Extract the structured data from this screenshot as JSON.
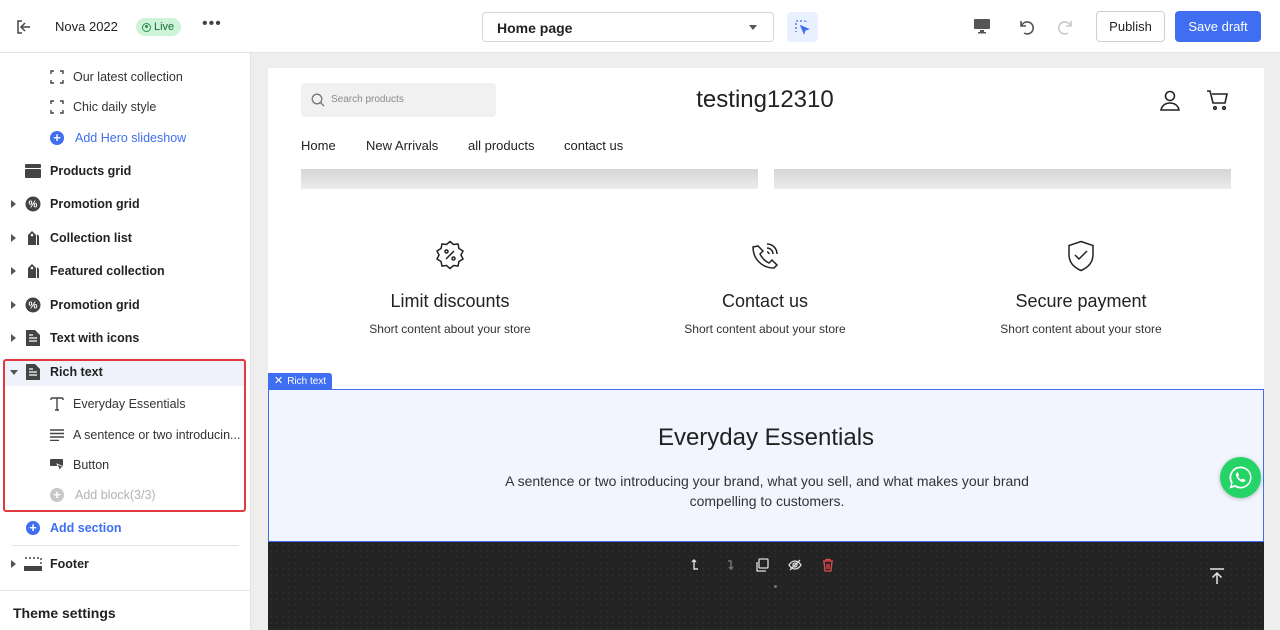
{
  "topbar": {
    "store_name": "Nova 2022",
    "status_badge": "Live",
    "more_label": "•••",
    "page_select_value": "Home page",
    "publish_label": "Publish",
    "save_draft_label": "Save draft"
  },
  "sidebar": {
    "items": [
      {
        "label": "Our latest collection",
        "icon": "slide-frame-icon"
      },
      {
        "label": "Chic daily style",
        "icon": "slide-frame-icon"
      },
      {
        "label": "Add Hero slideshow",
        "icon": "add-circle-icon"
      },
      {
        "label": "Products grid",
        "icon": "grid-icon"
      },
      {
        "label": "Promotion grid",
        "icon": "percent-badge-icon"
      },
      {
        "label": "Collection list",
        "icon": "tag-icon"
      },
      {
        "label": "Featured collection",
        "icon": "tag-icon"
      },
      {
        "label": "Promotion grid",
        "icon": "percent-badge-icon"
      },
      {
        "label": "Text with icons",
        "icon": "document-icon"
      },
      {
        "label": "Rich text",
        "icon": "document-icon"
      },
      {
        "label": "Everyday Essentials",
        "icon": "text-icon"
      },
      {
        "label": "A sentence or two introducin...",
        "icon": "paragraph-icon"
      },
      {
        "label": "Button",
        "icon": "button-icon"
      },
      {
        "label": "Add block(3/3)",
        "icon": "add-circle-icon"
      },
      {
        "label": "Add section",
        "icon": "add-circle-icon"
      },
      {
        "label": "Footer",
        "icon": "footer-icon"
      }
    ],
    "theme_settings_label": "Theme settings"
  },
  "preview": {
    "search_placeholder": "Search products",
    "store_title": "testing12310",
    "nav": [
      "Home",
      "New Arrivals",
      "all products",
      "contact us"
    ],
    "features": [
      {
        "title": "Limit discounts",
        "desc": "Short content about your store",
        "icon": "discount-badge-icon"
      },
      {
        "title": "Contact us",
        "desc": "Short content about your store",
        "icon": "phone-call-icon"
      },
      {
        "title": "Secure payment",
        "desc": "Short content about your store",
        "icon": "shield-check-icon"
      }
    ],
    "selected_tag": "Rich text",
    "rich_heading": "Everyday Essentials",
    "rich_paragraph": "A sentence or two introducing your brand, what you sell, and what makes your brand compelling to customers."
  },
  "colors": {
    "accent": "#3f6ef0",
    "highlight_border": "#e0393e",
    "live_badge_bg": "#cdf4d8",
    "footer_bg": "#232323",
    "whatsapp": "#25d366"
  }
}
